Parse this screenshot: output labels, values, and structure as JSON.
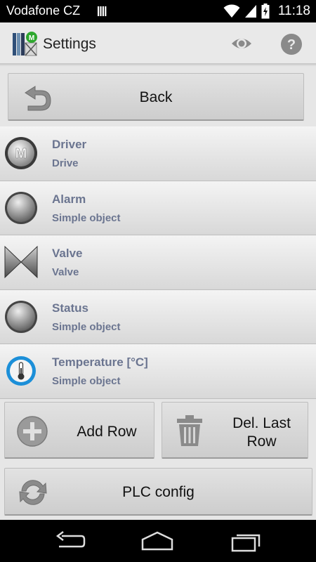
{
  "status_bar": {
    "carrier": "Vodafone CZ",
    "time": "11:18",
    "icons": [
      "sim-icon",
      "wifi-icon",
      "signal-icon",
      "battery-icon"
    ]
  },
  "action_bar": {
    "title": "Settings",
    "icons": [
      "app-logo-icon",
      "eye-icon",
      "help-icon"
    ]
  },
  "back_button": {
    "label": "Back",
    "icon": "undo-arrow-icon"
  },
  "rows": [
    {
      "title": "Driver",
      "subtitle": "Drive",
      "icon": "motor-icon"
    },
    {
      "title": "Alarm",
      "subtitle": "Simple object",
      "icon": "gray-lamp-icon"
    },
    {
      "title": "Valve",
      "subtitle": "Valve",
      "icon": "valve-icon"
    },
    {
      "title": "Status",
      "subtitle": "Simple object",
      "icon": "gray-lamp-icon"
    },
    {
      "title": "Temperature [°C]",
      "subtitle": "Simple object",
      "icon": "thermometer-icon"
    }
  ],
  "buttons": {
    "add_row": "Add Row",
    "del_last_row_line1": "Del. Last",
    "del_last_row_line2": "Row",
    "plc_config": "PLC config"
  },
  "nav_bar": {
    "icons": [
      "back-icon",
      "home-icon",
      "recents-icon"
    ]
  },
  "colors": {
    "accent_text": "#6b7590",
    "background": "#e6e6e6",
    "bars": "#000000"
  }
}
